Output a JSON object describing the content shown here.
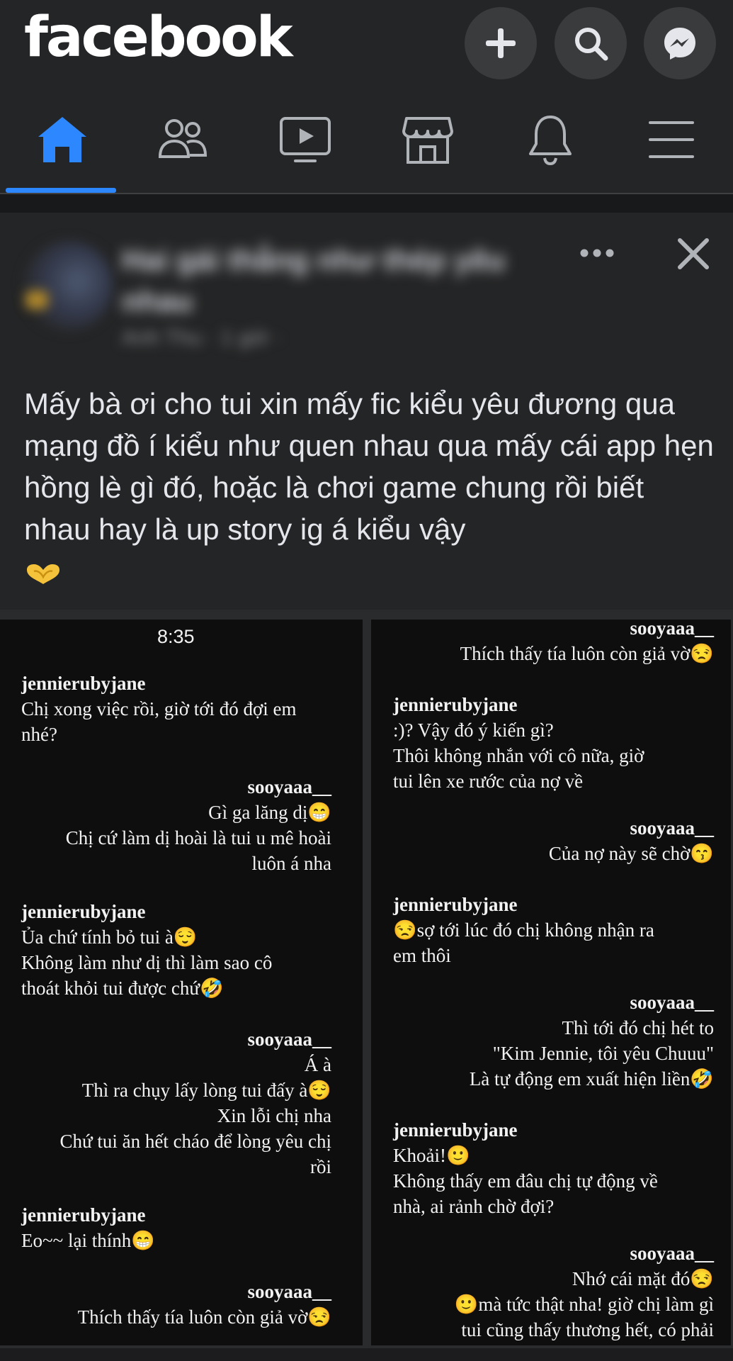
{
  "app": {
    "logo": "facebook"
  },
  "header": {
    "buttons": [
      {
        "name": "create-button",
        "icon": "plus-icon"
      },
      {
        "name": "search-button",
        "icon": "search-icon"
      },
      {
        "name": "messenger-button",
        "icon": "messenger-icon"
      }
    ]
  },
  "nav": {
    "tabs": [
      {
        "name": "tab-home",
        "icon": "home-icon",
        "active": true
      },
      {
        "name": "tab-friends",
        "icon": "friends-icon",
        "active": false
      },
      {
        "name": "tab-watch",
        "icon": "video-icon",
        "active": false
      },
      {
        "name": "tab-marketplace",
        "icon": "store-icon",
        "active": false
      },
      {
        "name": "tab-notifications",
        "icon": "bell-icon",
        "active": false
      },
      {
        "name": "tab-menu",
        "icon": "menu-icon",
        "active": false
      }
    ],
    "active_color": "#2d88ff"
  },
  "post": {
    "group_name_blurred": "Hai gái thẳng như thép yêu nhau",
    "meta_blurred": "Anh Thu · 1 giờ ·",
    "text": "Mấy bà ơi cho tui xin mấy fic kiểu yêu đương qua mạng đồ í kiểu như quen nhau qua mấy cái app hẹn hồng lè gì đó, hoặc là chơi game chung rồi biết nhau hay là up story ig á kiểu vậy",
    "emoji": "heart-hands-emoji"
  },
  "chat_image": {
    "time": "8:35",
    "left": [
      {
        "user": "jennierubyjane",
        "lines": [
          "Chị xong việc rồi, giờ tới đó đợi em",
          "nhé?"
        ]
      },
      {
        "user": "sooyaaa__",
        "lines": [
          "Gì ga lăng dị😁",
          "Chị cứ làm dị hoài là tui u mê hoài",
          "luôn á nha"
        ]
      },
      {
        "user": "jennierubyjane",
        "lines": [
          "Ủa chứ tính bỏ tui à😌",
          "Không làm như dị thì làm sao cô",
          "thoát khỏi tui được chứ🤣"
        ]
      },
      {
        "user": "sooyaaa__",
        "lines": [
          "Á à",
          "Thì ra chụy lấy lòng tui đấy à😌",
          "Xin lỗi chị nha",
          "Chứ tui ăn hết cháo để lòng yêu chị",
          "rồi"
        ]
      },
      {
        "user": "jennierubyjane",
        "lines": [
          "Eo~~ lại thính😁"
        ]
      },
      {
        "user": "sooyaaa__",
        "lines": [
          "Thích thấy tía luôn còn giả vờ😒"
        ]
      }
    ],
    "right": [
      {
        "user": "sooyaaa__",
        "lines": [
          "Thích thấy tía luôn còn giả vờ😒"
        ]
      },
      {
        "user": "jennierubyjane",
        "lines": [
          ":)? Vậy đó ý kiến gì?",
          "Thôi không nhắn với cô nữa, giờ",
          "tui lên xe rước của nợ về"
        ]
      },
      {
        "user": "sooyaaa__",
        "lines": [
          "Của nợ này sẽ chờ😙"
        ]
      },
      {
        "user": "jennierubyjane",
        "lines": [
          "😒sợ tới lúc đó chị không nhận ra",
          "em thôi"
        ]
      },
      {
        "user": "sooyaaa__",
        "lines": [
          "Thì tới đó chị hét to",
          "\"Kim Jennie, tôi yêu Chuuu\"",
          "Là tự động em xuất hiện liền🤣"
        ]
      },
      {
        "user": "jennierubyjane",
        "lines": [
          "Khoải!🙂",
          "Không thấy em đâu chị tự động về",
          "nhà, ai rảnh chờ đợi?"
        ]
      },
      {
        "user": "sooyaaa__",
        "lines": [
          "Nhớ cái mặt đó😒",
          "🙂mà tức thật nha! giờ chị làm gì",
          "tui cũng thấy thương hết, có phải"
        ]
      }
    ]
  }
}
